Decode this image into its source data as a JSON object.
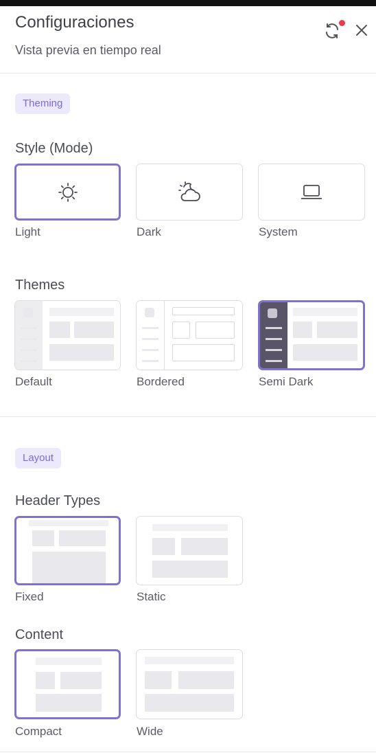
{
  "header": {
    "title": "Configuraciones",
    "subtitle": "Vista previa en tiempo real",
    "refresh_icon": "refresh-icon",
    "close_icon": "close-icon",
    "notification_color": "#ea3b4a"
  },
  "theming": {
    "chip": "Theming",
    "style_label": "Style (Mode)",
    "styles": [
      {
        "label": "Light",
        "icon": "sun-icon",
        "selected": true
      },
      {
        "label": "Dark",
        "icon": "cloud-moon-icon",
        "selected": false
      },
      {
        "label": "System",
        "icon": "laptop-icon",
        "selected": false
      }
    ],
    "themes_label": "Themes",
    "themes": [
      {
        "label": "Default",
        "selected": false
      },
      {
        "label": "Bordered",
        "selected": false
      },
      {
        "label": "Semi Dark",
        "selected": true
      }
    ]
  },
  "layout": {
    "chip": "Layout",
    "header_types_label": "Header Types",
    "header_types": [
      {
        "label": "Fixed",
        "selected": true
      },
      {
        "label": "Static",
        "selected": false
      }
    ],
    "content_label": "Content",
    "content": [
      {
        "label": "Compact",
        "selected": true
      },
      {
        "label": "Wide",
        "selected": false
      }
    ]
  },
  "colors": {
    "accent": "#7f72ce",
    "chip_bg": "#ece9fd",
    "chip_text": "#7b69e0",
    "semi_dark_sidebar": "#5a5468"
  }
}
